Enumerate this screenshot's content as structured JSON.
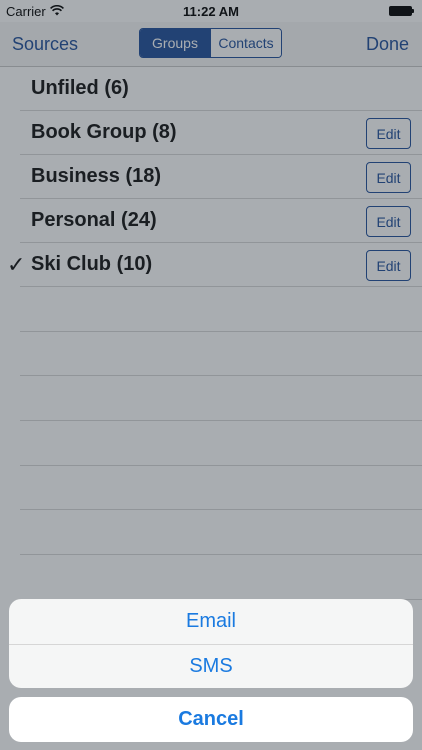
{
  "status_bar": {
    "carrier": "Carrier",
    "time": "11:22 AM",
    "wifi_icon": "wifi-icon",
    "battery_icon": "battery-full-icon"
  },
  "nav": {
    "left_label": "Sources",
    "right_label": "Done",
    "segments": [
      {
        "label": "Groups",
        "selected": true
      },
      {
        "label": "Contacts",
        "selected": false
      }
    ]
  },
  "groups": [
    {
      "label": "Unfiled (6)",
      "checked": false,
      "edit": null
    },
    {
      "label": "Book Group (8)",
      "checked": false,
      "edit": "Edit"
    },
    {
      "label": "Business (18)",
      "checked": false,
      "edit": "Edit"
    },
    {
      "label": "Personal (24)",
      "checked": false,
      "edit": "Edit"
    },
    {
      "label": "Ski Club (10)",
      "checked": true,
      "check_glyph": "✓",
      "edit": "Edit"
    }
  ],
  "action_sheet": {
    "items": [
      "Email",
      "SMS"
    ],
    "cancel": "Cancel"
  },
  "colors": {
    "accent": "#1f4e9a",
    "action_text": "#1a7ae0"
  }
}
